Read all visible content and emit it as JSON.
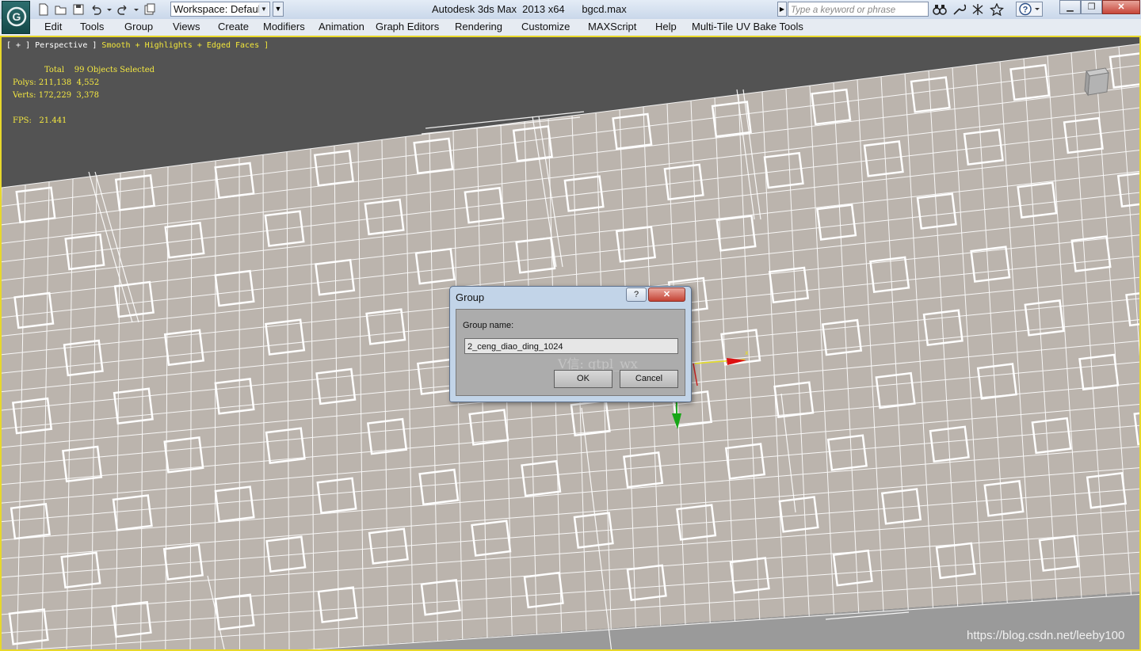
{
  "titlebar": {
    "workspace": "Workspace: Default",
    "app_title": "Autodesk 3ds Max  2013 x64      bgcd.max",
    "search_placeholder": "Type a keyword or phrase"
  },
  "menu": [
    "Edit",
    "Tools",
    "Group",
    "Views",
    "Create",
    "Modifiers",
    "Animation",
    "Graph Editors",
    "Rendering",
    "Customize",
    "MAXScript",
    "Help",
    "Multi-Tile UV Bake Tools"
  ],
  "viewport": {
    "label_prefix": "[ + ] Perspective ] ",
    "label_mode": "Smooth + Highlights + Edged Faces ]",
    "stats": {
      "header": "Total    99 Objects Selected",
      "polys": "Polys: 211,138  4,552",
      "verts": "Verts: 172,229  3,378",
      "fps": "FPS:   21.441"
    },
    "watermark": "https://blog.csdn.net/leeby100"
  },
  "dialog": {
    "title": "Group",
    "help_symbol": "?",
    "close_symbol": "✕",
    "group_name_label": "Group name:",
    "group_name_value": "2_ceng_diao_ding_1024",
    "ghost_text": "V信: qtpl_wx",
    "ok_label": "OK",
    "cancel_label": "Cancel"
  },
  "colors": {
    "viewport_border": "#e8d82a",
    "ceiling_fill": "#bbb4ad",
    "grid_line": "#ffffff",
    "stats_text": "#f4e841"
  }
}
